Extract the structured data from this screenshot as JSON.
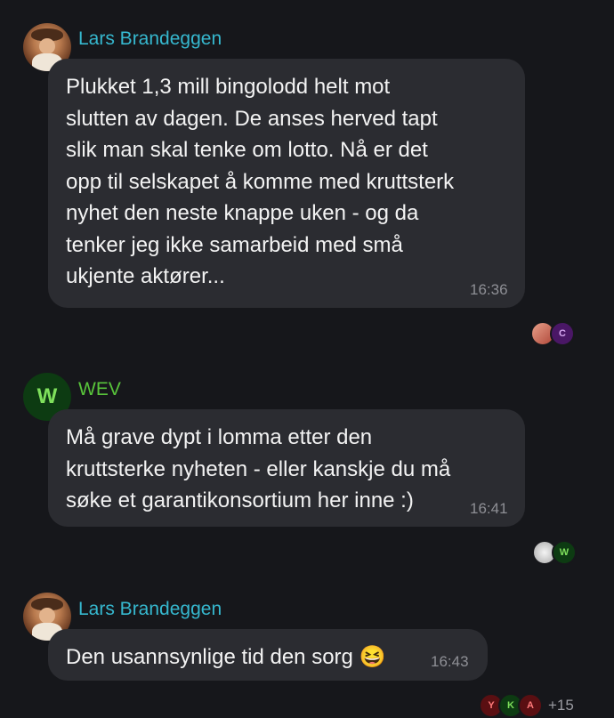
{
  "colors": {
    "background": "#16171b",
    "bubble": "#2b2c31",
    "lars_name": "#36b8cf",
    "wev_name": "#58c43b",
    "timestamp": "#8e8f95"
  },
  "messages": [
    {
      "sender": "Lars Brandeggen",
      "avatar": "cowboy-photo",
      "text": "Plukket 1,3 mill bingolodd helt mot\nslutten av dagen. De anses herved tapt\nslik man skal tenke om lotto. Nå er det\nopp til selskapet å komme med kruttsterk\nnyhet den neste knappe uken - og da\ntenker jeg ikke samarbeid med små\nukjente aktører...",
      "time": "16:36",
      "read_by": [
        "photo",
        "C"
      ]
    },
    {
      "sender": "WEV",
      "avatar_letter": "W",
      "text": "Må grave dypt i lomma etter den\nkruttsterke nyheten - eller kanskje du må\nsøke et garantikonsortium her inne :)",
      "time": "16:41",
      "read_by": [
        "photo",
        "W"
      ]
    },
    {
      "sender": "Lars Brandeggen",
      "avatar": "cowboy-photo",
      "text": "Den usannsynlige tid den sorg 😆",
      "time": "16:43",
      "read_by": [
        "Y",
        "K",
        "A"
      ],
      "read_more": "+15"
    }
  ]
}
